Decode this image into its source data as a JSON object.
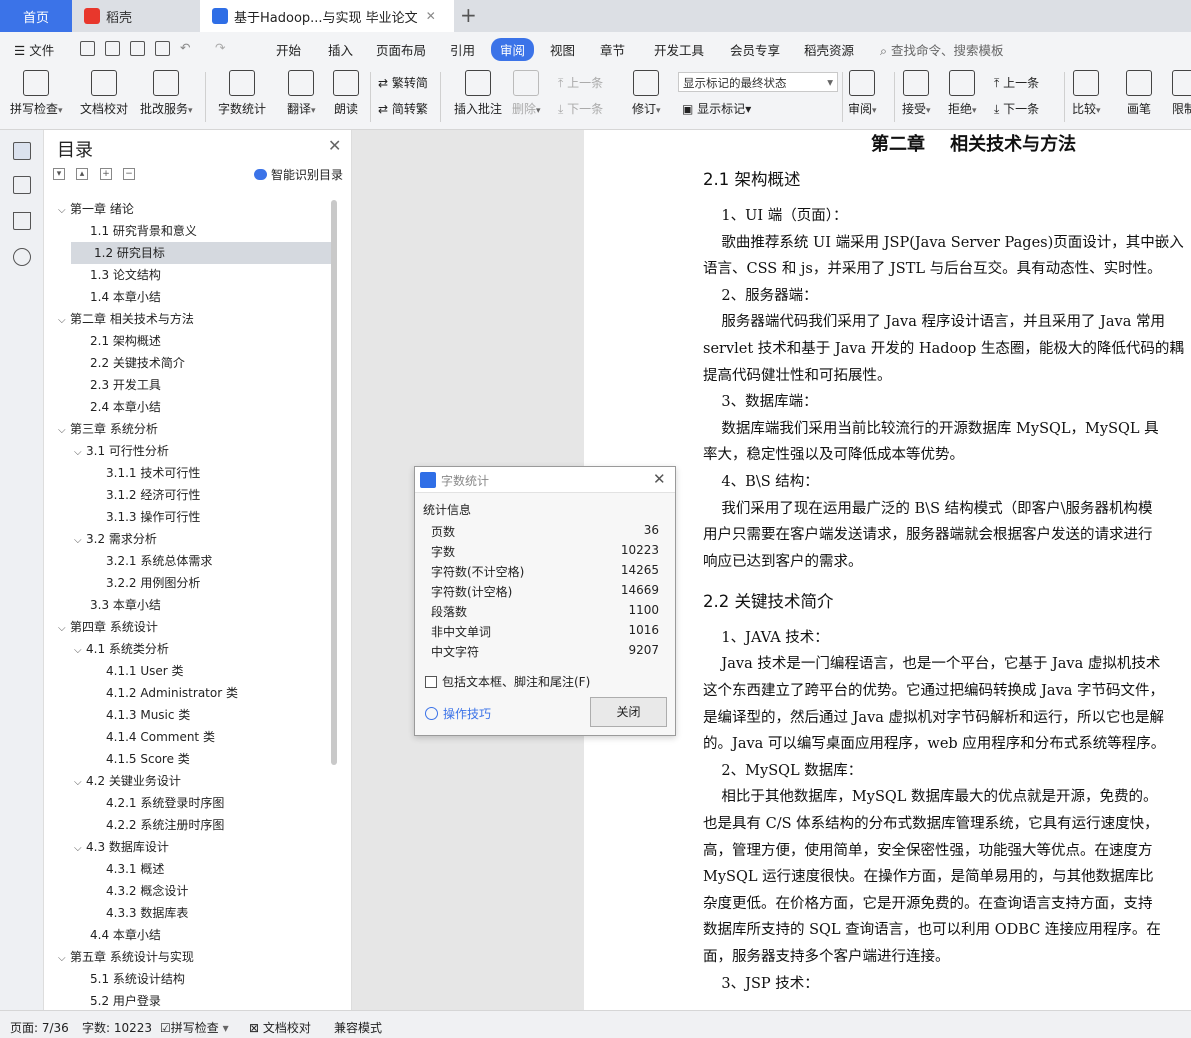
{
  "tabs": {
    "home": "首页",
    "doc1": "稻壳",
    "doc2": "基于Hadoop...与实现 毕业论文"
  },
  "menu": {
    "file": "文件",
    "items": [
      "开始",
      "插入",
      "页面布局",
      "引用",
      "审阅",
      "视图",
      "章节",
      "开发工具",
      "会员专享",
      "稻壳资源"
    ],
    "active": "审阅",
    "search": "查找命令、搜索模板"
  },
  "ribbon": {
    "spell": "拼写检查",
    "proofread": "文档校对",
    "annotate_service": "批改服务",
    "word_count": "字数统计",
    "translate": "翻译",
    "read_aloud": "朗读",
    "trad": "繁转简",
    "simp": "简转繁",
    "insert_comment": "插入批注",
    "delete": "删除",
    "prev": "上一条",
    "next": "下一条",
    "revise": "修订",
    "markup_select": "显示标记的最终状态",
    "show_markup": "显示标记",
    "review": "审阅",
    "accept": "接受",
    "reject": "拒绝",
    "prev2": "上一条",
    "next2": "下一条",
    "compare": "比较",
    "pen": "画笔",
    "restrict": "限制"
  },
  "toc": {
    "title": "目录",
    "smart": "智能识别目录",
    "items": [
      {
        "level": 1,
        "label": "第一章   绪论",
        "arrow": true
      },
      {
        "level": 2,
        "label": "1.1 研究背景和意义"
      },
      {
        "level": 2,
        "label": "1.2 研究目标",
        "selected": true
      },
      {
        "level": 2,
        "label": "1.3 论文结构"
      },
      {
        "level": 2,
        "label": "1.4 本章小结"
      },
      {
        "level": 1,
        "label": "第二章  相关技术与方法",
        "arrow": true
      },
      {
        "level": 2,
        "label": "2.1 架构概述"
      },
      {
        "level": 2,
        "label": "2.2 关键技术简介"
      },
      {
        "level": 2,
        "label": "2.3 开发工具"
      },
      {
        "level": 2,
        "label": "2.4 本章小结"
      },
      {
        "level": 1,
        "label": "第三章  系统分析",
        "arrow": true
      },
      {
        "level": 2,
        "label": "3.1 可行性分析",
        "arrow": true
      },
      {
        "level": 3,
        "label": "3.1.1 技术可行性"
      },
      {
        "level": 3,
        "label": "3.1.2 经济可行性"
      },
      {
        "level": 3,
        "label": "3.1.3  操作可行性"
      },
      {
        "level": 2,
        "label": "3.2  需求分析",
        "arrow": true
      },
      {
        "level": 3,
        "label": "3.2.1 系统总体需求"
      },
      {
        "level": 3,
        "label": "3.2.2 用例图分析"
      },
      {
        "level": 2,
        "label": "3.3 本章小结"
      },
      {
        "level": 1,
        "label": "第四章  系统设计",
        "arrow": true
      },
      {
        "level": 2,
        "label": "4.1 系统类分析",
        "arrow": true
      },
      {
        "level": 3,
        "label": "4.1.1 User 类"
      },
      {
        "level": 3,
        "label": "4.1.2 Administrator 类"
      },
      {
        "level": 3,
        "label": "4.1.3 Music 类"
      },
      {
        "level": 3,
        "label": "4.1.4 Comment 类"
      },
      {
        "level": 3,
        "label": "4.1.5 Score 类"
      },
      {
        "level": 2,
        "label": "4.2 关键业务设计",
        "arrow": true
      },
      {
        "level": 3,
        "label": "4.2.1 系统登录时序图"
      },
      {
        "level": 3,
        "label": "4.2.2 系统注册时序图"
      },
      {
        "level": 2,
        "label": "4.3 数据库设计",
        "arrow": true
      },
      {
        "level": 3,
        "label": "4.3.1 概述"
      },
      {
        "level": 3,
        "label": "4.3.2 概念设计"
      },
      {
        "level": 3,
        "label": "4.3.3 数据库表"
      },
      {
        "level": 2,
        "label": "4.4 本章小结"
      },
      {
        "level": 1,
        "label": "第五章  系统设计与实现",
        "arrow": true
      },
      {
        "level": 2,
        "label": "5.1 系统设计结构"
      },
      {
        "level": 2,
        "label": "5.2 用户登录"
      }
    ]
  },
  "document": {
    "lines": [
      {
        "type": "h1",
        "text": "第二章    相关技术与方法"
      },
      {
        "type": "h2",
        "text": "2.1 架构概述"
      },
      {
        "type": "p",
        "text": "    1、UI 端（页面）："
      },
      {
        "type": "p",
        "text": "    歌曲推荐系统 UI 端采用 JSP(Java Server Pages)页面设计，其中嵌入"
      },
      {
        "type": "p",
        "text": "语言、CSS 和 js，并采用了 JSTL 与后台互交。具有动态性、实时性。"
      },
      {
        "type": "p",
        "text": "    2、服务器端："
      },
      {
        "type": "p",
        "text": "    服务器端代码我们采用了 Java 程序设计语言，并且采用了 Java 常用"
      },
      {
        "type": "p",
        "text": "servlet 技术和基于 Java 开发的 Hadoop 生态圈，能极大的降低代码的耦"
      },
      {
        "type": "p",
        "text": "提高代码健壮性和可拓展性。"
      },
      {
        "type": "p",
        "text": "    3、数据库端："
      },
      {
        "type": "p",
        "text": "    数据库端我们采用当前比较流行的开源数据库 MySQL，MySQL 具"
      },
      {
        "type": "p",
        "text": "率大，稳定性强以及可降低成本等优势。"
      },
      {
        "type": "p",
        "text": "    4、B\\S 结构："
      },
      {
        "type": "p",
        "text": "    我们采用了现在运用最广泛的 B\\S 结构模式（即客户\\服务器机构模"
      },
      {
        "type": "p",
        "text": "用户只需要在客户端发送请求，服务器端就会根据客户发送的请求进行"
      },
      {
        "type": "p",
        "text": "响应已达到客户的需求。"
      },
      {
        "type": "h2",
        "text": "2.2 关键技术简介"
      },
      {
        "type": "p",
        "text": "    1、JAVA 技术："
      },
      {
        "type": "p",
        "text": "    Java 技术是一门编程语言，也是一个平台，它基于 Java 虚拟机技术"
      },
      {
        "type": "p",
        "text": "这个东西建立了跨平台的优势。它通过把编码转换成 Java 字节码文件，"
      },
      {
        "type": "p",
        "text": "是编译型的，然后通过 Java 虚拟机对字节码解析和运行，所以它也是解"
      },
      {
        "type": "p",
        "text": "的。Java 可以编写桌面应用程序，web 应用程序和分布式系统等程序。"
      },
      {
        "type": "p",
        "text": "    2、MySQL 数据库："
      },
      {
        "type": "p",
        "text": "    相比于其他数据库，MySQL 数据库最大的优点就是开源，免费的。"
      },
      {
        "type": "p",
        "text": "也是具有 C/S 体系结构的分布式数据库管理系统，它具有运行速度快，"
      },
      {
        "type": "p",
        "text": "高，管理方便，使用简单，安全保密性强，功能强大等优点。在速度方"
      },
      {
        "type": "p",
        "text": "MySQL 运行速度很快。在操作方面，是简单易用的，与其他数据库比"
      },
      {
        "type": "p",
        "text": "杂度更低。在价格方面，它是开源免费的。在查询语言支持方面，支持"
      },
      {
        "type": "p",
        "text": "数据库所支持的 SQL 查询语言，也可以利用 ODBC 连接应用程序。在"
      },
      {
        "type": "p",
        "text": "面，服务器支持多个客户端进行连接。"
      },
      {
        "type": "p",
        "text": "    3、JSP 技术："
      }
    ]
  },
  "dialog": {
    "title": "字数统计",
    "section": "统计信息",
    "stats": [
      {
        "label": "页数",
        "value": "36"
      },
      {
        "label": "字数",
        "value": "10223"
      },
      {
        "label": "字符数(不计空格)",
        "value": "14265"
      },
      {
        "label": "字符数(计空格)",
        "value": "14669"
      },
      {
        "label": "段落数",
        "value": "1100"
      },
      {
        "label": "非中文单词",
        "value": "1016"
      },
      {
        "label": "中文字符",
        "value": "9207"
      }
    ],
    "checkbox": "包括文本框、脚注和尾注(F)",
    "tips": "操作技巧",
    "close": "关闭"
  },
  "status": {
    "page": "页面: 7/36",
    "words": "字数: 10223",
    "spell": "拼写检查",
    "proofread": "文档校对",
    "compat": "兼容模式"
  },
  "colors": {
    "accent": "#3b73e8",
    "tab_bar": "#dcdfe4",
    "toc_selected": "#d5d9df"
  }
}
